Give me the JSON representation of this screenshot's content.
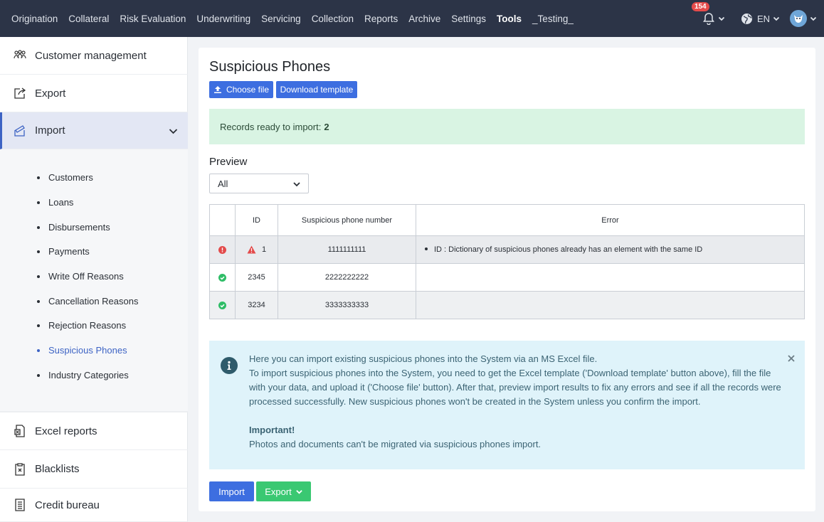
{
  "topnav": {
    "items": [
      "Origination",
      "Collateral",
      "Risk Evaluation",
      "Underwriting",
      "Servicing",
      "Collection",
      "Reports",
      "Archive",
      "Settings",
      "Tools",
      "_Testing_"
    ],
    "active": "Tools",
    "notification_count": "154",
    "language": "EN"
  },
  "sidebar": {
    "customer_management": "Customer management",
    "export": "Export",
    "import": "Import",
    "sub_items": [
      "Customers",
      "Loans",
      "Disbursements",
      "Payments",
      "Write Off Reasons",
      "Cancellation Reasons",
      "Rejection Reasons",
      "Suspicious Phones",
      "Industry Categories"
    ],
    "active_sub": "Suspicious Phones",
    "excel_reports": "Excel reports",
    "blacklists": "Blacklists",
    "credit_bureau": "Credit bureau"
  },
  "main": {
    "title": "Suspicious Phones",
    "choose_file": "Choose file",
    "download_template": "Download template",
    "ready_text": "Records ready to import:",
    "ready_count": "2",
    "preview_label": "Preview",
    "filter_value": "All",
    "table": {
      "headers": [
        "",
        "ID",
        "Suspicious phone number",
        "Error"
      ],
      "rows": [
        {
          "status": "error",
          "id": "1",
          "phone": "1111111111",
          "error": "ID : Dictionary of suspicious phones already has an element with the same ID"
        },
        {
          "status": "ok",
          "id": "2345",
          "phone": "2222222222",
          "error": ""
        },
        {
          "status": "ok",
          "id": "3234",
          "phone": "3333333333",
          "error": ""
        }
      ]
    },
    "info": {
      "line1": "Here you can import existing suspicious phones into the System via an MS Excel file.",
      "line2": "To import suspicious phones into the System, you need to get the Excel template ('Download template' button above), fill the file with your data, and upload it ('Choose file' button). After that, preview import results to fix any errors and see if all the records were processed successfully. New suspicious phones won't be created in the System unless you confirm the import.",
      "important_title": "Important!",
      "important_text": "Photos and documents can't be migrated via suspicious phones import."
    },
    "import_button": "Import",
    "export_button": "Export"
  },
  "colors": {
    "nav_bg": "#2c3447",
    "primary": "#3d6ee0",
    "success": "#3ac872",
    "danger": "#e34b4b",
    "info_bg": "#dff3fa"
  }
}
